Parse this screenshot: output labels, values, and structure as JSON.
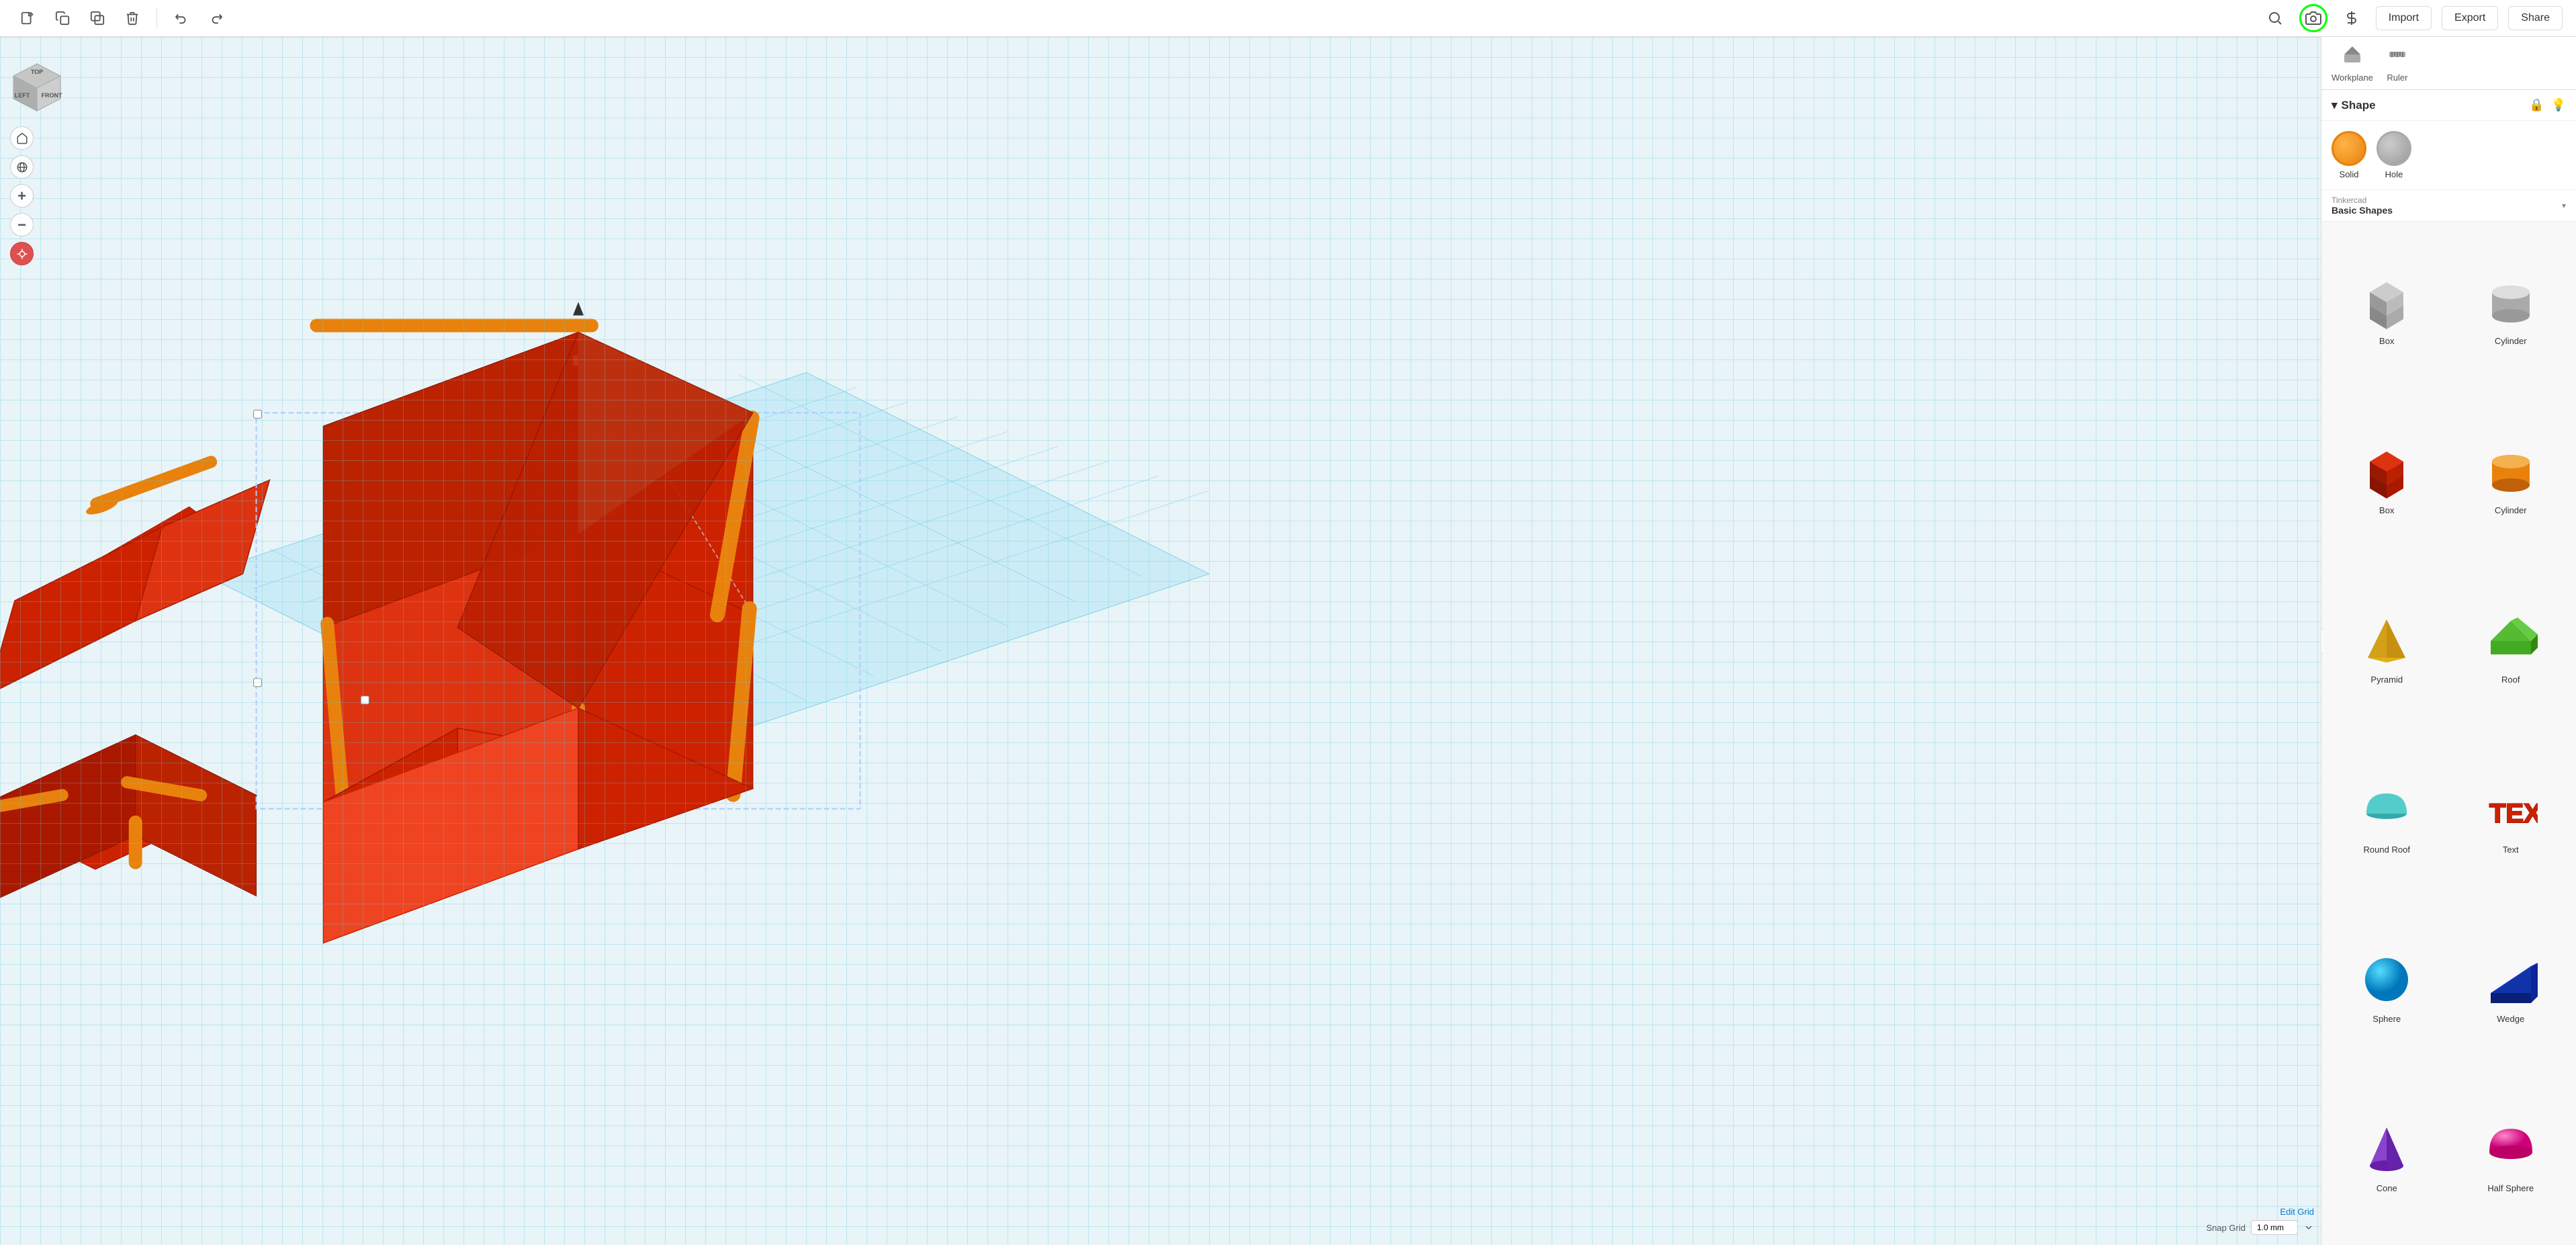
{
  "toolbar": {
    "buttons": [
      {
        "id": "new",
        "icon": "⊕",
        "label": "New"
      },
      {
        "id": "copy",
        "icon": "⧉",
        "label": "Copy"
      },
      {
        "id": "duplicate",
        "icon": "❐",
        "label": "Duplicate"
      },
      {
        "id": "delete",
        "icon": "🗑",
        "label": "Delete"
      },
      {
        "id": "undo",
        "icon": "↩",
        "label": "Undo"
      },
      {
        "id": "redo",
        "icon": "↪",
        "label": "Redo"
      }
    ],
    "import_label": "Import",
    "export_label": "Export",
    "share_label": "Share"
  },
  "shape_panel": {
    "title": "Shape",
    "solid_label": "Solid",
    "hole_label": "Hole"
  },
  "shapes_library": {
    "header": {
      "workplane_label": "Workplane",
      "ruler_label": "Ruler"
    },
    "category": {
      "provider": "Tinkercad",
      "name": "Basic Shapes"
    },
    "shapes": [
      {
        "id": "box-gray",
        "label": "Box",
        "color": "#aaaaaa",
        "type": "box-gray"
      },
      {
        "id": "cylinder-gray",
        "label": "Cylinder",
        "color": "#bbbbbb",
        "type": "cylinder-gray"
      },
      {
        "id": "box-red",
        "label": "Box",
        "color": "#cc2200",
        "type": "box-red"
      },
      {
        "id": "cylinder-orange",
        "label": "Cylinder",
        "color": "#e8820c",
        "type": "cylinder-orange"
      },
      {
        "id": "pyramid",
        "label": "Pyramid",
        "color": "#f0c020",
        "type": "pyramid"
      },
      {
        "id": "roof",
        "label": "Roof",
        "color": "#44aa22",
        "type": "roof"
      },
      {
        "id": "round-roof",
        "label": "Round Roof",
        "color": "#44bbbb",
        "type": "round-roof"
      },
      {
        "id": "text",
        "label": "Text",
        "color": "#cc0000",
        "type": "text"
      },
      {
        "id": "sphere",
        "label": "Sphere",
        "color": "#00aadd",
        "type": "sphere"
      },
      {
        "id": "wedge",
        "label": "Wedge",
        "color": "#001a99",
        "type": "wedge"
      },
      {
        "id": "cone",
        "label": "Cone",
        "color": "#8800cc",
        "type": "cone"
      },
      {
        "id": "half-sphere",
        "label": "Half Sphere",
        "color": "#cc0088",
        "type": "half-sphere"
      }
    ]
  },
  "grid": {
    "edit_grid_label": "Edit Grid",
    "snap_grid_label": "Snap Grid",
    "snap_value": "1.0 mm"
  }
}
